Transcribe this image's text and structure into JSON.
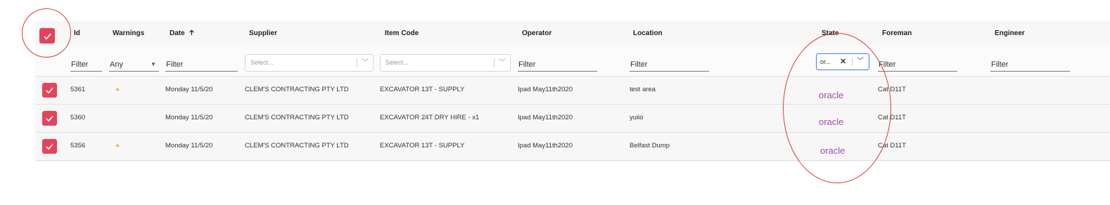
{
  "columns": {
    "id": "Id",
    "warnings": "Warnings",
    "date": "Date",
    "date_sort_icon": "arrow-up-icon",
    "supplier": "Supplier",
    "item_code": "Item Code",
    "operator": "Operator",
    "location": "Location",
    "state": "State",
    "foreman": "Foreman",
    "engineer": "Engineer"
  },
  "filters": {
    "id": "Filter",
    "warnings": "Any",
    "date": "Filter",
    "supplier_placeholder": "Select...",
    "item_code_placeholder": "Select...",
    "operator": "Filter",
    "location": "Filter",
    "state_value": "or...",
    "foreman": "Filter",
    "engineer": "Filter"
  },
  "rows": [
    {
      "id": "5361",
      "warning": true,
      "date": "Monday 11/5/20",
      "supplier": "CLEM'S CONTRACTING PTY LTD",
      "item_code": "EXCAVATOR 13T - SUPPLY",
      "operator": "Ipad May11th2020",
      "location": "test area",
      "state": "oracle",
      "foreman": "Cat D11T",
      "engineer": ""
    },
    {
      "id": "5360",
      "warning": false,
      "date": "Monday 11/5/20",
      "supplier": "CLEM'S CONTRACTING PTY LTD",
      "item_code": "EXCAVATOR 24T DRY HIRE - x1",
      "operator": "Ipad May11th2020",
      "location": "yuiio",
      "state": "oracle",
      "foreman": "Cat D11T",
      "engineer": ""
    },
    {
      "id": "5356",
      "warning": true,
      "date": "Monday 11/5/20",
      "supplier": "CLEM'S CONTRACTING PTY LTD",
      "item_code": "EXCAVATOR 13T - SUPPLY",
      "operator": "Ipad May11th2020",
      "location": "Belfast Dump",
      "state": "oracle",
      "foreman": "Cat D11T",
      "engineer": ""
    }
  ],
  "icons": {
    "checkbox": "check-icon",
    "warning": "warning-triangle-icon",
    "dropdown": "chevron-down-icon",
    "clear": "clear-x-icon"
  },
  "colors": {
    "checkbox": "#e8425a",
    "state_text": "#9b4fb0",
    "annotation": "#e23a3a",
    "warning": "#f2b01e",
    "focus_border": "#3f7fe0"
  }
}
